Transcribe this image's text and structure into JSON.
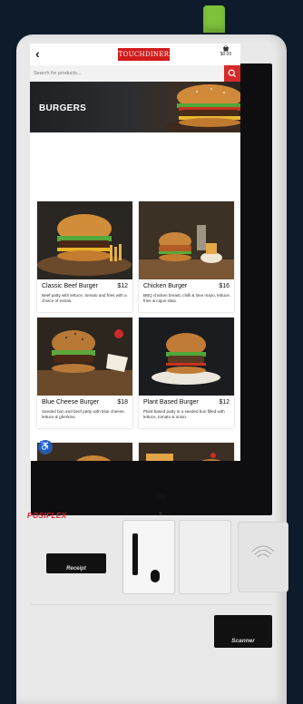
{
  "header": {
    "back_label": "‹",
    "logo_text": "TOUCHDINER",
    "cart_total": "$0.00"
  },
  "search": {
    "placeholder": "Search for products..."
  },
  "category": {
    "title": "BURGERS"
  },
  "products": [
    {
      "name": "Classic Beef Burger",
      "price": "$12",
      "description": "Beef patty with lettuce, tomato and fries with a choice of extras."
    },
    {
      "name": "Chicken Burger",
      "price": "$16",
      "description": "BBQ chicken breast, chilli & lime mayo, lettuce, fries & cajun slaw."
    },
    {
      "name": "Blue Cheese Burger",
      "price": "$18",
      "description": "Seeded bun and beef patty with blue cheese, lettuce & gherkins."
    },
    {
      "name": "Plant Based Burger",
      "price": "$12",
      "description": "Plant based patty in a seeded bun filled with lettuce, tomato & onion."
    }
  ],
  "kiosk": {
    "brand": "POSIFLEX",
    "receipt_label": "Receipt",
    "scanner_label": "Scanner"
  },
  "colors": {
    "accent": "#d11b1b",
    "led": "#7ec23a",
    "accessibility": "#2c5aa0"
  }
}
